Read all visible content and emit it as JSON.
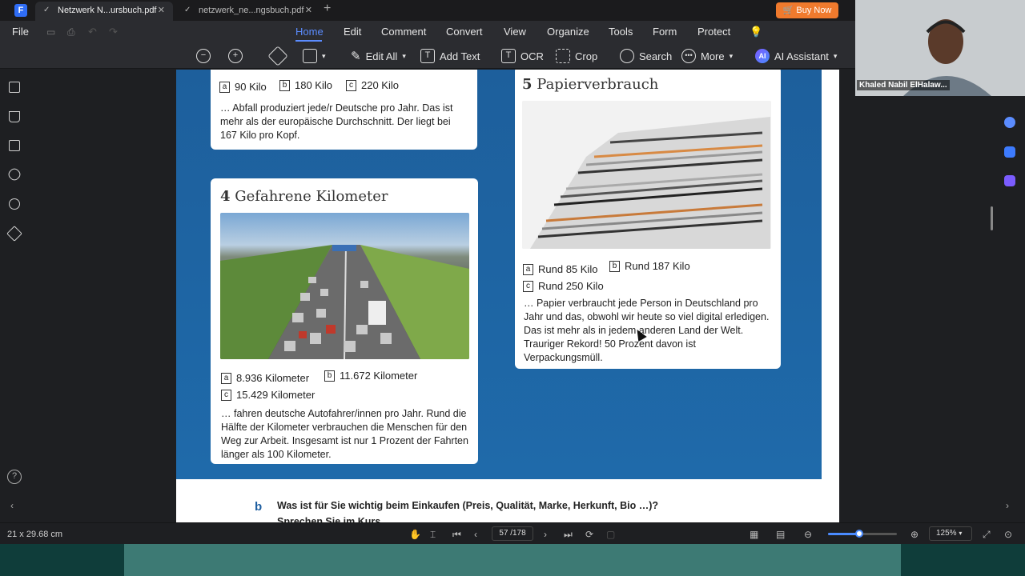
{
  "tabs": [
    {
      "label": "Netzwerk N...ursbuch.pdf",
      "active": true
    },
    {
      "label": "netzwerk_ne...ngsbuch.pdf",
      "active": false
    }
  ],
  "buy_now": "Buy Now",
  "menu": {
    "file": "File",
    "items": [
      "Home",
      "Edit",
      "Comment",
      "Convert",
      "View",
      "Organize",
      "Tools",
      "Form",
      "Protect"
    ],
    "active": "Home"
  },
  "toolbar": {
    "edit_all": "Edit All",
    "add_text": "Add Text",
    "ocr": "OCR",
    "crop": "Crop",
    "search": "Search",
    "more": "More",
    "ai_assistant": "AI Assistant"
  },
  "webcam_name": "Khaled Nabil ElHalaw...",
  "page": {
    "card3": {
      "options": [
        {
          "letter": "a",
          "text": "90 Kilo"
        },
        {
          "letter": "b",
          "text": "180 Kilo"
        },
        {
          "letter": "c",
          "text": "220 Kilo"
        }
      ],
      "text": "… Abfall produziert jede/r Deutsche pro Jahr. Das ist mehr als der europäische Durchschnitt. Der liegt bei 167 Kilo pro Kopf."
    },
    "card4": {
      "number": "4",
      "title": "Gefahrene Kilometer",
      "options": [
        {
          "letter": "a",
          "text": "8.936 Kilometer"
        },
        {
          "letter": "b",
          "text": "11.672 Kilometer"
        },
        {
          "letter": "c",
          "text": "15.429 Kilometer"
        }
      ],
      "text": "… fahren deutsche Autofahrer/innen pro Jahr. Rund die Hälfte der Kilometer verbrauchen die Menschen für den Weg zur Arbeit. Insgesamt ist nur 1 Prozent der Fahrten länger als 100 Kilometer."
    },
    "card5": {
      "number": "5",
      "title": "Papierverbrauch",
      "options": [
        {
          "letter": "a",
          "text": "Rund 85 Kilo"
        },
        {
          "letter": "b",
          "text": "Rund 187 Kilo"
        },
        {
          "letter": "c",
          "text": "Rund 250 Kilo"
        }
      ],
      "text": "… Papier verbraucht jede Person in Deutschland pro Jahr und das, obwohl wir heute so viel digital erledigen. Das ist mehr als in jedem anderen Land der Welt. Trauriger Rekord! 50 Prozent davon ist Verpackungsmüll."
    },
    "task_letter": "b",
    "task_question": "Was ist für Sie wichtig beim Einkaufen (Preis, Qualität, Marke, Herkunft, Bio …)?",
    "task_next": "Sprechen Sie im Kurs."
  },
  "status": {
    "page_size": "21 x 29.68 cm",
    "page_indicator": "57 /178",
    "zoom": "125%",
    "zoom_fraction": 0.45
  }
}
